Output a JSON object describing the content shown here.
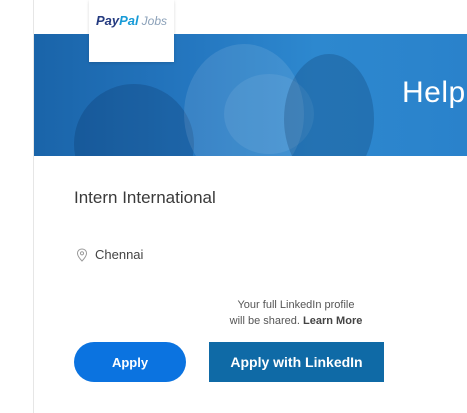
{
  "logo": {
    "pay": "Pay",
    "pal": "Pal",
    "jobs": "Jobs",
    "brand_colors": {
      "pay": "#253b80",
      "pal": "#179bd7"
    }
  },
  "hero": {
    "text": "Help"
  },
  "job": {
    "title": "Intern International",
    "location": "Chennai",
    "location_icon": "map-pin-icon"
  },
  "share_note": {
    "line1": "Your full LinkedIn profile",
    "line2_prefix": "will be shared.",
    "learn_more": "Learn More"
  },
  "actions": {
    "apply_label": "Apply",
    "apply_linkedin_label": "Apply with LinkedIn"
  },
  "colors": {
    "apply_button": "#0b73e0",
    "linkedin_button": "#0f6aa6",
    "hero_blue": "#2476bf"
  }
}
